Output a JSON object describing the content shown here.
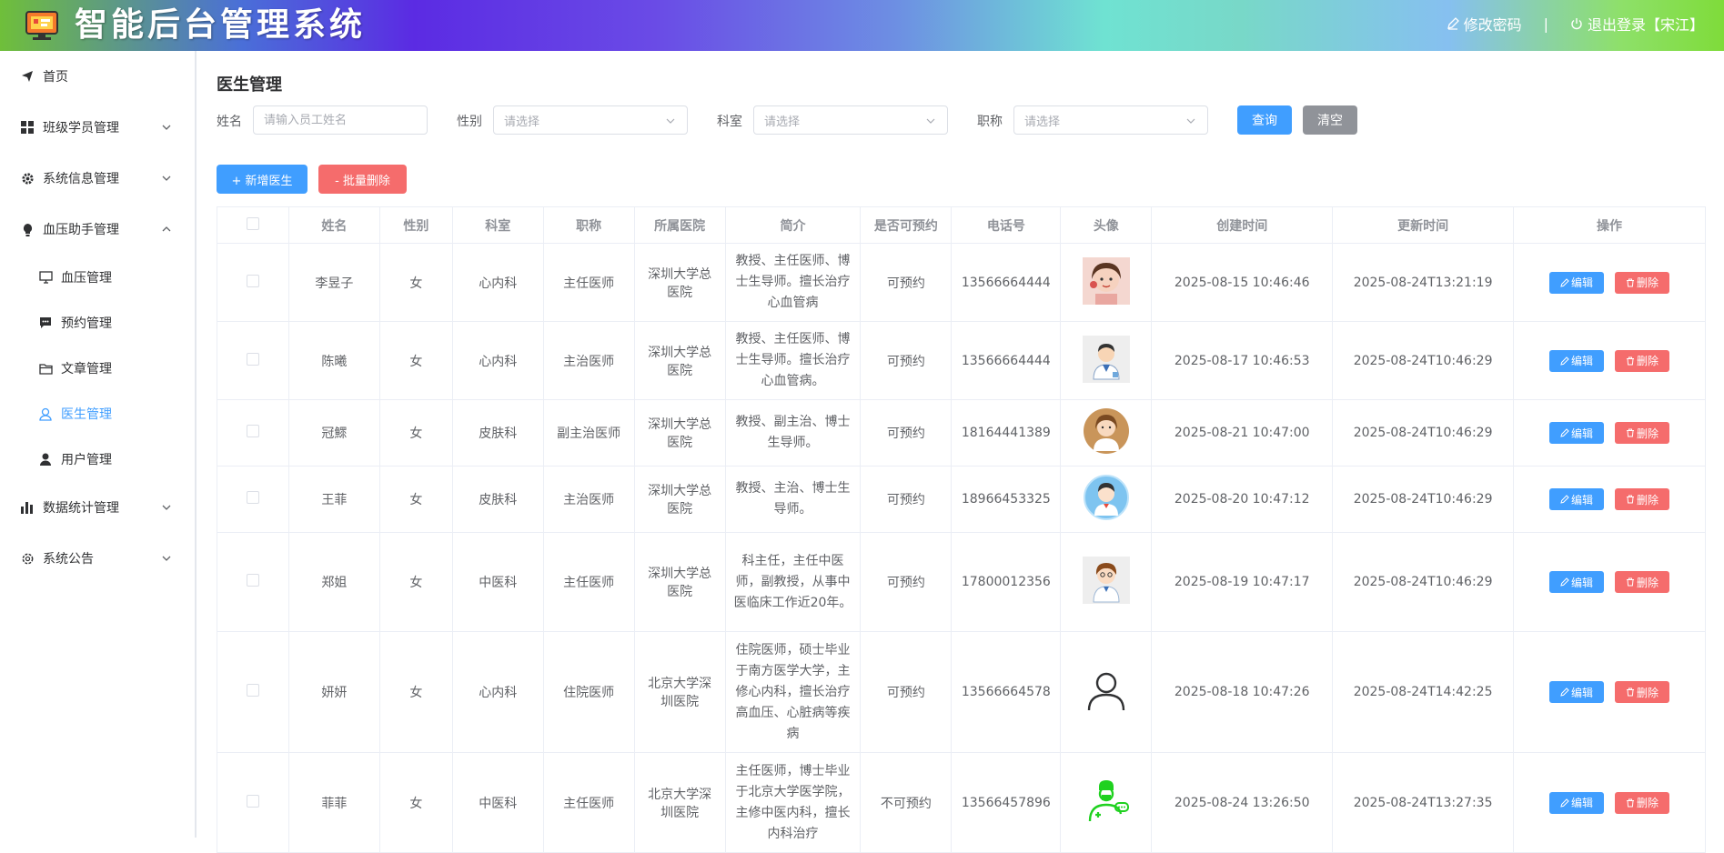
{
  "header": {
    "title": "智能后台管理系统",
    "change_password": "修改密码",
    "separator": "|",
    "logout": "退出登录【宋江】"
  },
  "sidebar": {
    "items": [
      {
        "label": "首页",
        "icon": "send-icon"
      },
      {
        "label": "班级学员管理",
        "icon": "grid-icon"
      },
      {
        "label": "系统信息管理",
        "icon": "gear-icon"
      },
      {
        "label": "血压助手管理",
        "icon": "bulb-icon"
      },
      {
        "label": "血压管理",
        "icon": "monitor-icon"
      },
      {
        "label": "预约管理",
        "icon": "chat-icon"
      },
      {
        "label": "文章管理",
        "icon": "folder-icon"
      },
      {
        "label": "医生管理",
        "icon": "user-outline-icon"
      },
      {
        "label": "用户管理",
        "icon": "user-icon"
      },
      {
        "label": "数据统计管理",
        "icon": "bar-chart-icon"
      },
      {
        "label": "系统公告",
        "icon": "settings-icon"
      }
    ]
  },
  "main": {
    "title": "医生管理",
    "filters": {
      "name_label": "姓名",
      "name_placeholder": "请输入员工姓名",
      "gender_label": "性别",
      "gender_placeholder": "请选择",
      "dept_label": "科室",
      "dept_placeholder": "请选择",
      "title_label": "职称",
      "title_placeholder": "请选择",
      "query": "查询",
      "clear": "清空"
    },
    "actions": {
      "add": "+ 新增医生",
      "batch_delete": "- 批量删除"
    },
    "columns": [
      "姓名",
      "性别",
      "科室",
      "职称",
      "所属医院",
      "简介",
      "是否可预约",
      "电话号",
      "头像",
      "创建时间",
      "更新时间",
      "操作"
    ],
    "edit_label": "编辑",
    "delete_label": "删除",
    "rows": [
      {
        "name": "李昱子",
        "gender": "女",
        "dept": "心内科",
        "title": "主任医师",
        "hospital": "深圳大学总医院",
        "intro": "教授、主任医师、博士生导师。擅长治疗心血管病",
        "bookable": "可预约",
        "phone": "13566664444",
        "avatar": "photo-girl-avatar",
        "created": "2025-08-15 10:46:46",
        "updated": "2025-08-24T13:21:19"
      },
      {
        "name": "陈曦",
        "gender": "女",
        "dept": "心内科",
        "title": "主治医师",
        "hospital": "深圳大学总医院",
        "intro": "教授、主任医师、博士生导师。擅长治疗心血管病。",
        "bookable": "可预约",
        "phone": "13566664444",
        "avatar": "doctor-cartoon-avatar",
        "created": "2025-08-17 10:46:53",
        "updated": "2025-08-24T10:46:29"
      },
      {
        "name": "冠鰥",
        "gender": "女",
        "dept": "皮肤科",
        "title": "副主治医师",
        "hospital": "深圳大学总医院",
        "intro": "教授、副主治、博士生导师。",
        "bookable": "可预约",
        "phone": "18164441389",
        "avatar": "female-doctor-avatar",
        "created": "2025-08-21 10:47:00",
        "updated": "2025-08-24T10:46:29"
      },
      {
        "name": "王菲",
        "gender": "女",
        "dept": "皮肤科",
        "title": "主治医师",
        "hospital": "深圳大学总医院",
        "intro": "教授、主治、博士生导师。",
        "bookable": "可预约",
        "phone": "18966453325",
        "avatar": "blue-doctor-avatar",
        "created": "2025-08-20 10:47:12",
        "updated": "2025-08-24T10:46:29"
      },
      {
        "name": "郑姐",
        "gender": "女",
        "dept": "中医科",
        "title": "主任医师",
        "hospital": "深圳大学总医院",
        "intro": "科主任，主任中医师，副教授，从事中医临床工作近20年。",
        "bookable": "可预约",
        "phone": "17800012356",
        "avatar": "brown-hair-doctor-avatar",
        "created": "2025-08-19 10:47:17",
        "updated": "2025-08-24T10:46:29"
      },
      {
        "name": "妍妍",
        "gender": "女",
        "dept": "心内科",
        "title": "住院医师",
        "hospital": "北京大学深圳医院",
        "intro": "住院医师，硕士毕业于南方医学大学，主修心内科，擅长治疗高血压、心脏病等疾病",
        "bookable": "可预约",
        "phone": "13566664578",
        "avatar": "outline-person-avatar",
        "created": "2025-08-18 10:47:26",
        "updated": "2025-08-24T14:42:25"
      },
      {
        "name": "菲菲",
        "gender": "女",
        "dept": "中医科",
        "title": "主任医师",
        "hospital": "北京大学深圳医院",
        "intro": "主任医师，博士毕业于北京大学医学院，主修中医内科，擅长内科治疗",
        "bookable": "不可预约",
        "phone": "13566457896",
        "avatar": "green-doctor-avatar",
        "created": "2025-08-24 13:26:50",
        "updated": "2025-08-24T13:27:35"
      }
    ]
  }
}
